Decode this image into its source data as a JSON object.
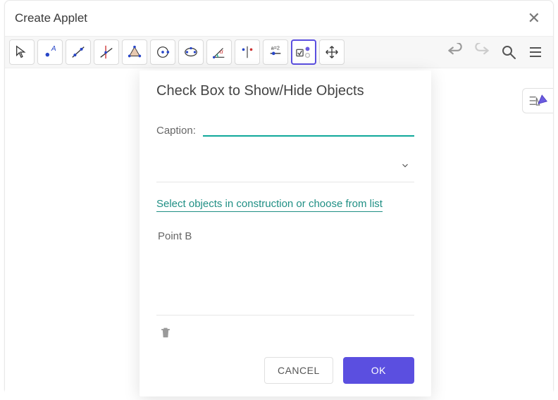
{
  "window": {
    "title": "Create Applet"
  },
  "toolbar": {
    "tools": [
      "move",
      "point",
      "line",
      "perpendicular",
      "polygon",
      "circle",
      "ellipse",
      "angle",
      "reflect",
      "slider",
      "checkbox",
      "translate"
    ],
    "selected_index": 10
  },
  "dialog": {
    "title": "Check Box to Show/Hide Objects",
    "caption_label": "Caption:",
    "caption_value": "",
    "select_prompt": "Select objects in construction or choose from list",
    "objects": [
      "Point B"
    ],
    "buttons": {
      "cancel": "CANCEL",
      "ok": "OK"
    }
  }
}
